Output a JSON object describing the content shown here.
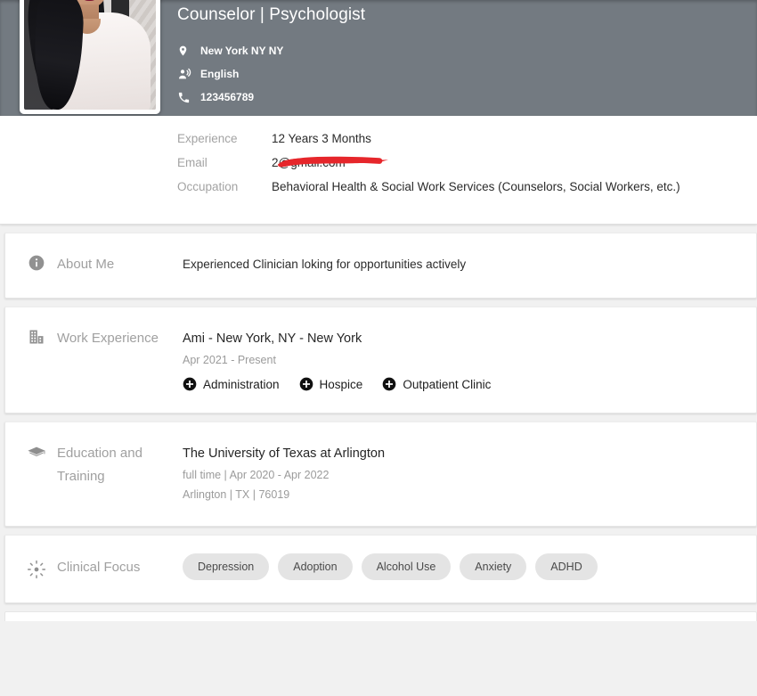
{
  "header": {
    "title": "Counselor | Psychologist",
    "banner_color": "#737a81",
    "avatar_alt": "profile-photo",
    "meta": [
      {
        "icon": "location-pin-icon",
        "text": "New York NY NY"
      },
      {
        "icon": "language-speaking-icon",
        "text": "English"
      },
      {
        "icon": "phone-icon",
        "text": "123456789"
      }
    ]
  },
  "details": {
    "rows": [
      {
        "label": "Experience",
        "value": "12 Years 3 Months",
        "redacted": false
      },
      {
        "label": "Email",
        "value": "2@gmail.com",
        "redacted": true,
        "redaction_color": "#e6262b"
      },
      {
        "label": "Occupation",
        "value": "Behavioral Health & Social Work Services (Counselors, Social Workers, etc.)",
        "redacted": false
      }
    ]
  },
  "about": {
    "icon": "info-circle-icon",
    "title": "About Me",
    "text": "Experienced Clinician loking for opportunities actively"
  },
  "work_experience": {
    "icon": "building-icon",
    "title": "Work Experience",
    "entry": {
      "heading": "Ami - New York, NY - New York",
      "dates": "Apr 2021 - Present",
      "tags": [
        "Administration",
        "Hospice",
        "Outpatient Clinic"
      ]
    }
  },
  "education": {
    "icon": "graduation-cap-icon",
    "title_line1": "Education and",
    "title_line2": "Training",
    "entry": {
      "heading": "The University of Texas at Arlington",
      "dates": "full time | Apr 2020 - Apr 2022",
      "location": "Arlington | TX | 76019"
    }
  },
  "clinical_focus": {
    "icon": "sunburst-icon",
    "title": "Clinical Focus",
    "chips": [
      "Depression",
      "Adoption",
      "Alcohol Use",
      "Anxiety",
      "ADHD"
    ]
  }
}
